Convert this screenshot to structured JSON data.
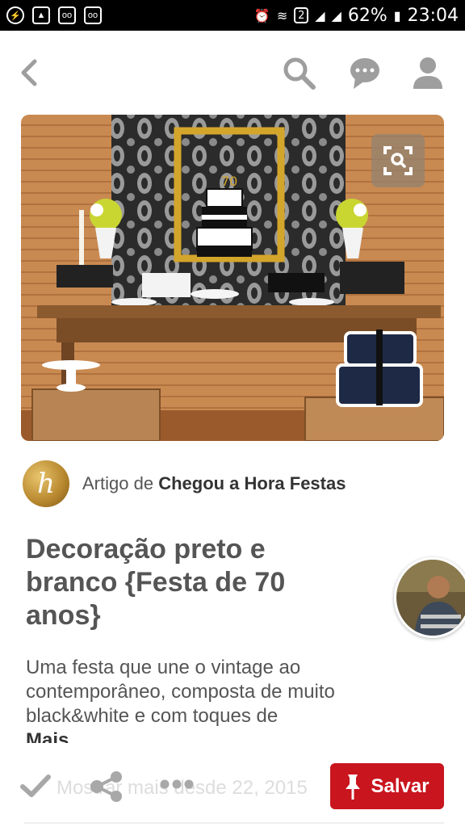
{
  "status_bar": {
    "left_icons": [
      "messenger-icon",
      "image-icon",
      "voicemail-icon",
      "voicemail-icon"
    ],
    "sim": "2",
    "battery": "62%",
    "time": "23:04"
  },
  "top_bar": {
    "icons": [
      "back-icon",
      "search-icon",
      "chat-icon",
      "profile-icon"
    ]
  },
  "pin": {
    "source_prefix": "Artigo de",
    "source_name": "Chegou a Hora Festas",
    "source_logo_letter": "h",
    "title": "Decoração preto e branco {Festa de 70 anos}",
    "description": "Uma festa que une o vintage ao contemporâneo, composta de muito black&white e com toques de",
    "more": "Mais"
  },
  "action_bar": {
    "ghost_text": "Mostrar mais desde 22, 2015",
    "save_label": "Salvar"
  },
  "colors": {
    "accent": "#c9151e",
    "icon_gray": "#9e9e9e"
  }
}
